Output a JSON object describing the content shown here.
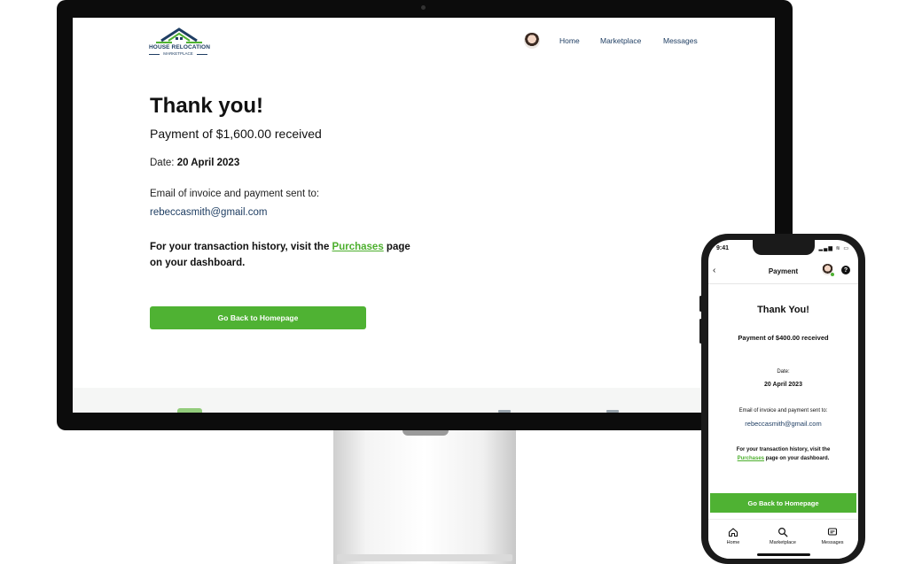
{
  "desktop": {
    "logo": {
      "name": "HOUSE RELOCATION",
      "subtitle": "MARKETPLACE"
    },
    "nav": {
      "home": "Home",
      "marketplace": "Marketplace",
      "messages": "Messages"
    },
    "title": "Thank you!",
    "payment": "Payment of $1,600.00 received",
    "date_label": "Date: ",
    "date_value": "20 April 2023",
    "email_label": "Email of invoice and payment sent to:",
    "email": "rebeccasmith@gmail.com",
    "history_before": "For your transaction history, visit the ",
    "history_link": "Purchases",
    "history_after": " page on your dashboard.",
    "button": "Go Back to Homepage"
  },
  "mobile": {
    "status_time": "9:41",
    "status_icons": "▂▄▆ ≋ ▭",
    "header_title": "Payment",
    "back_icon": "‹",
    "help_icon": "?",
    "title": "Thank You!",
    "payment": "Payment of $400.00 received",
    "date_label": "Date:",
    "date_value": "20 April 2023",
    "email_label": "Email of invoice and payment sent to:",
    "email": "rebeccasmith@gmail.com",
    "history_before": "For your transaction history, visit the",
    "history_link": "Purchases",
    "history_after": " page on your dashboard.",
    "button": "Go Back to Homepage",
    "tabs": [
      {
        "label": "Home",
        "icon": "home-icon"
      },
      {
        "label": "Marketplace",
        "icon": "search-icon"
      },
      {
        "label": "Messages",
        "icon": "message-icon"
      }
    ]
  },
  "colors": {
    "accent_green": "#4fb233",
    "link_green": "#4caf2d",
    "navy": "#1f3e63"
  }
}
